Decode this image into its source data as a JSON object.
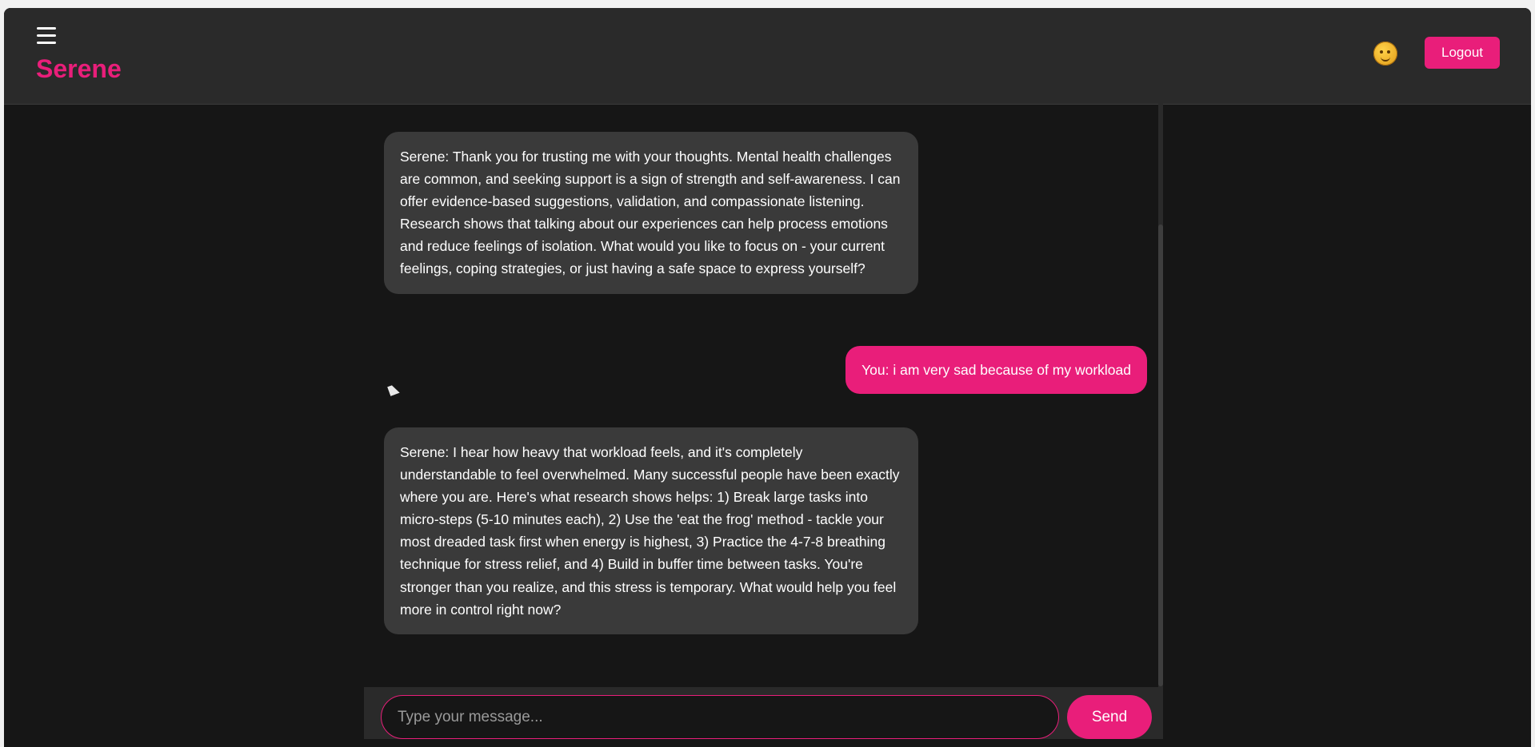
{
  "header": {
    "brand": "Serene",
    "logout_label": "Logout"
  },
  "messages": [
    {
      "role": "bot",
      "text": "Serene: Thank you for trusting me with your thoughts. Mental health challenges are common, and seeking support is a sign of strength and self-awareness. I can offer evidence-based suggestions, validation, and compassionate listening. Research shows that talking about our experiences can help process emotions and reduce feelings of isolation. What would you like to focus on - your current feelings, coping strategies, or just having a safe space to express yourself?"
    },
    {
      "role": "user",
      "text": "You: i am very sad because of my workload"
    },
    {
      "role": "bot",
      "text": "Serene: I hear how heavy that workload feels, and it's completely understandable to feel overwhelmed. Many successful people have been exactly where you are. Here's what research shows helps: 1) Break large tasks into micro-steps (5-10 minutes each), 2) Use the 'eat the frog' method - tackle your most dreaded task first when energy is highest, 3) Practice the 4-7-8 breathing technique for stress relief, and 4) Build in buffer time between tasks. You're stronger than you realize, and this stress is temporary. What would help you feel more in control right now?"
    }
  ],
  "composer": {
    "placeholder": "Type your message...",
    "value": "",
    "send_label": "Send"
  },
  "colors": {
    "accent": "#e91e7a",
    "background": "#161616",
    "header": "#2a2a2a",
    "bot_bubble": "#3a3a3a"
  },
  "icons": {
    "menu": "hamburger-menu-icon",
    "avatar": "smiley-avatar-icon"
  }
}
